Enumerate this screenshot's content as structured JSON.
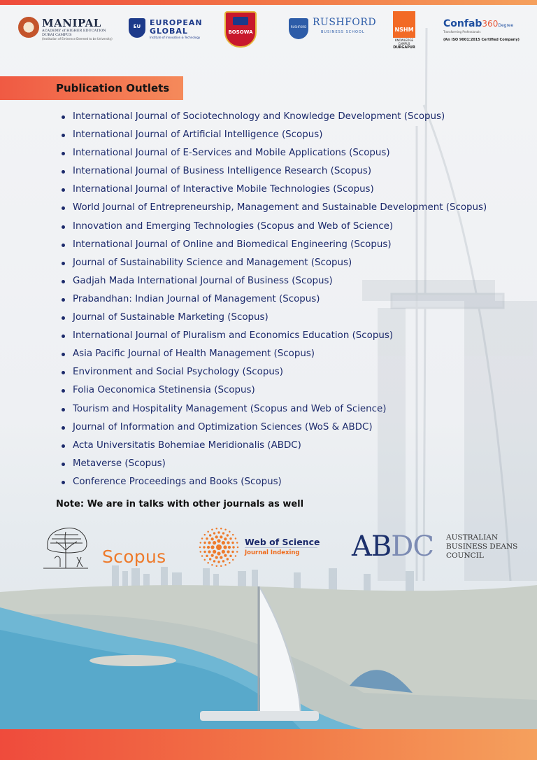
{
  "header_logos": {
    "manipal": {
      "name": "MANIPAL",
      "line1": "ACADEMY of HIGHER EDUCATION",
      "line2": "DUBAI CAMPUS",
      "line3": "(Institution of Eminence Deemed to be University)"
    },
    "european_global": {
      "shield": "EU",
      "line1": "EUROPEAN",
      "line2": "GLOBAL",
      "line3": "Institute of Innovation & Technology"
    },
    "bosowa": {
      "label": "BOSOWA"
    },
    "rushford": {
      "badge": "RUSHFORD",
      "name": "RUSHFORD",
      "sub": "BUSINESS SCHOOL"
    },
    "nshm": {
      "mark": "NSHM",
      "line1": "KNOWLEDGE CAMPUS",
      "line2": "DURGAPUR"
    },
    "confab": {
      "name": "Confab",
      "number": "360",
      "degree": "Degree",
      "tagline": "Transforming Professionals",
      "iso": "(An ISO 9001:2015 Certified Company)"
    }
  },
  "section": {
    "title": "Publication Outlets"
  },
  "outlets": [
    "International Journal of Sociotechnology and Knowledge Development (Scopus)",
    "International Journal of Artificial Intelligence (Scopus)",
    "International Journal of E-Services and Mobile Applications (Scopus)",
    "International Journal of Business Intelligence Research (Scopus)",
    "International Journal of Interactive Mobile Technologies (Scopus)",
    "World Journal of Entrepreneurship, Management and Sustainable Development (Scopus)",
    "Innovation and Emerging Technologies (Scopus and Web of Science)",
    "International Journal of Online and Biomedical Engineering (Scopus)",
    "Journal of Sustainability Science and Management (Scopus)",
    "Gadjah Mada International Journal of Business (Scopus)",
    "Prabandhan: Indian Journal of Management (Scopus)",
    "Journal of Sustainable Marketing (Scopus)",
    "International Journal of Pluralism and Economics Education (Scopus)",
    "Asia Pacific Journal of Health Management (Scopus)",
    "Environment and Social Psychology (Scopus)",
    "Folia Oeconomica Stetinensia (Scopus)",
    "Tourism and Hospitality Management (Scopus and Web of Science)",
    "Journal of Information and Optimization Sciences (WoS & ABDC)",
    "Acta Universitatis Bohemiae Meridionalis (ABDC)",
    "Metaverse (Scopus)",
    "Conference Proceedings and Books (Scopus)"
  ],
  "note": "Note: We are in talks with other journals as well",
  "indexing": {
    "scopus": "Scopus",
    "wos_title": "Web of Science",
    "wos_sub": "Journal Indexing",
    "abdc_ab": "AB",
    "abdc_dc": "DC",
    "abdc_line1": "AUSTRALIAN",
    "abdc_line2": "BUSINESS DEANS",
    "abdc_line3": "COUNCIL"
  },
  "colors": {
    "accent_orange": "#f05a43",
    "list_text": "#1c2a6b",
    "scopus_orange": "#ee7a2a",
    "abdc_navy": "#1b2f6b"
  }
}
